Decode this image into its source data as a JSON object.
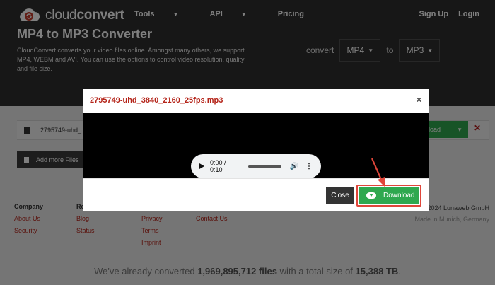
{
  "header": {
    "logo_light": "cloud",
    "logo_bold": "convert",
    "nav": [
      {
        "label": "Tools",
        "has_caret": true
      },
      {
        "label": "API",
        "has_caret": true
      },
      {
        "label": "Pricing",
        "has_caret": false
      }
    ],
    "sign_up": "Sign Up",
    "login": "Login"
  },
  "hero": {
    "title": "MP4 to MP3 Converter",
    "description": "CloudConvert converts your video files online. Amongst many others, we support MP4, WEBM and AVI. You can use the options to control video resolution, quality and file size.",
    "convert_label": "convert",
    "from_format": "MP4",
    "to_label": "to",
    "to_format": "MP3"
  },
  "job": {
    "file_name": "2795749-uhd_",
    "download_label": "load",
    "add_files": "Add more Files"
  },
  "footer": {
    "company": {
      "heading": "Company",
      "links": [
        "About Us",
        "Security"
      ]
    },
    "resources": {
      "heading": "Re",
      "links": [
        "Blog",
        "Status"
      ]
    },
    "legal": {
      "links": [
        "Privacy",
        "Terms",
        "Imprint"
      ]
    },
    "contact": {
      "links": [
        "Contact Us"
      ]
    },
    "copyright": "2024 Lunaweb GmbH",
    "made_in": "Made in Munich, Germany",
    "stats_prefix": "We've already converted",
    "files_count": "1,969,895,712 files",
    "stats_mid": "with a total size of",
    "total_size": "15,388 TB",
    "stats_suffix": "."
  },
  "modal": {
    "title": "2795749-uhd_3840_2160_25fps.mp3",
    "close_symbol": "×",
    "audio_time": "0:00 / 0:10",
    "close_button": "Close",
    "download_button": "Download"
  },
  "colors": {
    "accent_red": "#b42318",
    "green": "#2fa84f",
    "dark": "#2e2e2e",
    "highlight": "#e0463a"
  }
}
